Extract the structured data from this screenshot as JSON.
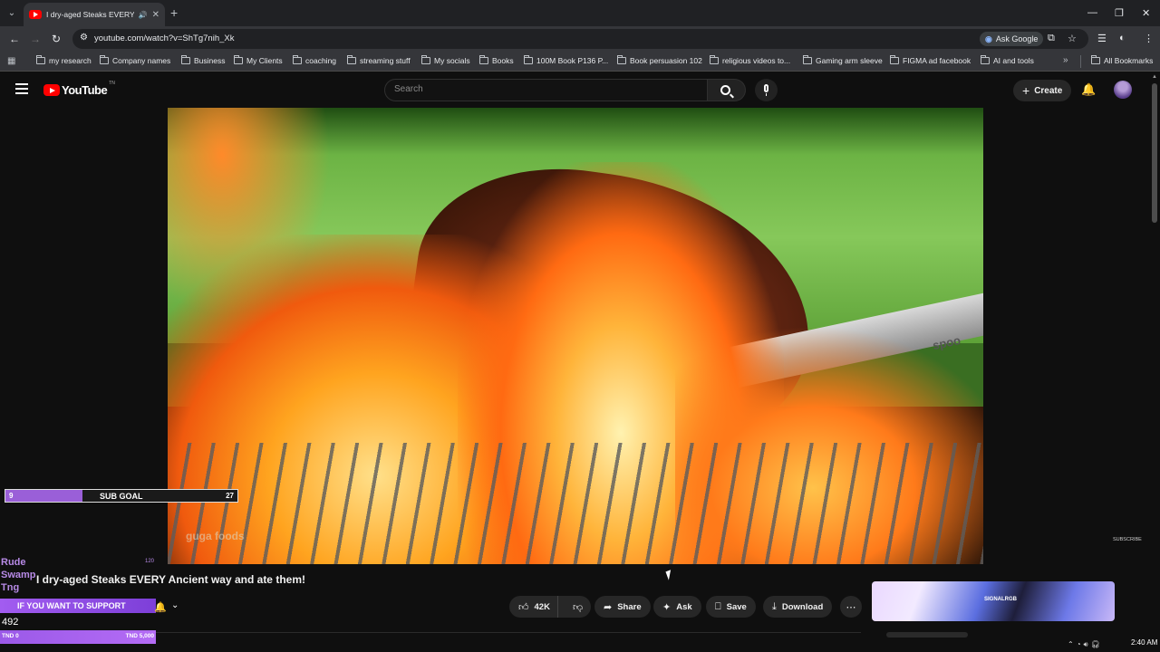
{
  "browser": {
    "tab_title": "I dry-aged Steaks EVERY Ancient way and ate them!",
    "url": "youtube.com/watch?v=ShTg7nih_Xk",
    "ask_google": "Ask Google",
    "bookmarks": [
      "my research",
      "Company names",
      "Business",
      "My Clients",
      "coaching",
      "streaming stuff",
      "My socials",
      "Books",
      "100M Book P136 P...",
      "Book persuasion 102",
      "religious videos to...",
      "Gaming arm sleeve",
      "FIGMA ad facebook",
      "AI and tools"
    ],
    "all_bookmarks": "All Bookmarks"
  },
  "youtube": {
    "logo": "YouTube",
    "logo_country": "TN",
    "search_placeholder": "Search",
    "create": "Create"
  },
  "video": {
    "title": "I dry-aged Steaks EVERY Ancient way and ate them!",
    "watermark": "guga foods",
    "tong_brand": "spoo",
    "subscribe_mark": "SUBSCRIBE"
  },
  "actions": {
    "likes": "42K",
    "share": "Share",
    "ask": "Ask",
    "save": "Save",
    "download": "Download"
  },
  "overlay": {
    "sub_goal_label": "SUB GOAL",
    "sub_goal_current": "9",
    "sub_goal_target": "27",
    "sub_goal_progress": 0.333,
    "alert_names": [
      "Rude",
      "Swamp",
      "Tng"
    ],
    "alert_count": "120",
    "support_banner": "IF YOU WANT TO SUPPORT",
    "support_amount": "492",
    "support_min": "TND 0",
    "support_max": "TND 5,000"
  },
  "ad": {
    "logo": "SIGNALRGB"
  },
  "system": {
    "time": "2:40 AM"
  }
}
